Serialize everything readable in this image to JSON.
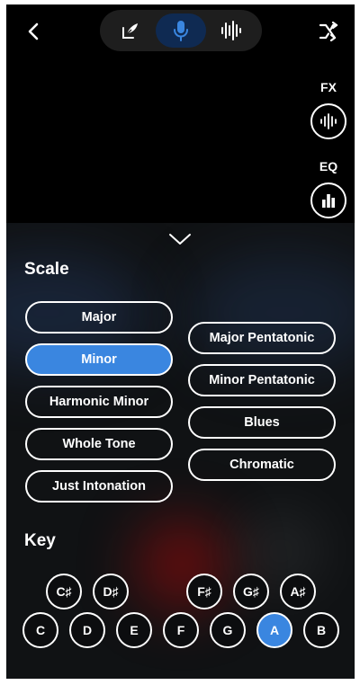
{
  "header": {
    "icons": {
      "back": "chevron-left-icon",
      "modes": [
        "feather-pen-icon",
        "microphone-icon",
        "waveform-icon"
      ],
      "shuffle": "shuffle-icon"
    },
    "active_mode_index": 1,
    "accent_color": "#3a86e0"
  },
  "side_controls": {
    "fx_label": "FX",
    "eq_label": "EQ"
  },
  "scale_section": {
    "title": "Scale",
    "left_column": [
      "Major",
      "Minor",
      "Harmonic Minor",
      "Whole Tone",
      "Just Intonation"
    ],
    "right_column": [
      "Major Pentatonic",
      "Minor Pentatonic",
      "Blues",
      "Chromatic"
    ],
    "selected": "Minor"
  },
  "key_section": {
    "title": "Key",
    "sharps": [
      "C♯",
      "D♯",
      "F♯",
      "G♯",
      "A♯"
    ],
    "naturals": [
      "C",
      "D",
      "E",
      "F",
      "G",
      "A",
      "B"
    ],
    "selected": "A"
  }
}
